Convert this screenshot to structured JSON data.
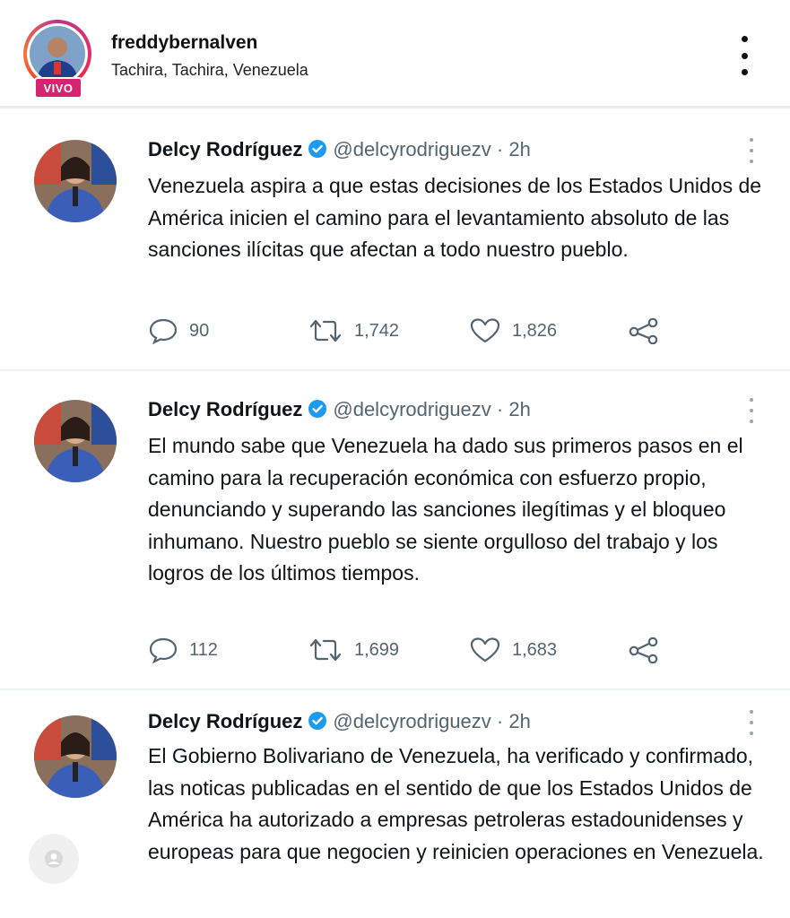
{
  "live_post": {
    "username": "freddybernalven",
    "location": "Tachira, Tachira, Venezuela",
    "live_badge": "VIVO"
  },
  "tweets": [
    {
      "name": "Delcy Rodríguez",
      "handle": "@delcyrodriguezv · 2h",
      "text": "Venezuela aspira a que estas decisiones de los Estados Unidos de América inicien el camino para el levantamiento absoluto de las sanciones ilícitas que afectan a todo nuestro pueblo.",
      "replies": "90",
      "retweets": "1,742",
      "likes": "1,826"
    },
    {
      "name": "Delcy Rodríguez",
      "handle": "@delcyrodriguezv · 2h",
      "text": "El mundo sabe que Venezuela ha dado sus primeros pasos en el camino para la recuperación económica con esfuerzo propio, denunciando y superando las sanciones ilegítimas y el bloqueo inhumano. Nuestro pueblo se siente orgulloso del trabajo y los logros de los últimos tiempos.",
      "replies": "112",
      "retweets": "1,699",
      "likes": "1,683"
    },
    {
      "name": "Delcy Rodríguez",
      "handle": "@delcyrodriguezv · 2h",
      "text": "El Gobierno Bolivariano de Venezuela, ha verificado y confirmado, las noticas publicadas en el sentido de que los Estados Unidos de América ha autorizado a empresas petroleras estadounidenses y europeas para que negocien y reinicien operaciones en Venezuela."
    }
  ],
  "colors": {
    "verified_blue": "#1d9bf0",
    "live_pink": "#d6246e",
    "muted_text": "#536471"
  }
}
